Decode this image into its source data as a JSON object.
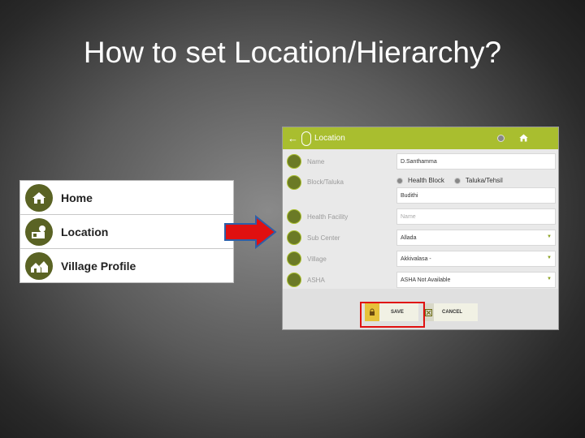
{
  "slide": {
    "title": "How to set Location/Hierarchy?"
  },
  "menu": {
    "items": [
      {
        "label": "Home",
        "icon": "home-icon"
      },
      {
        "label": "Location",
        "icon": "location-icon"
      },
      {
        "label": "Village Profile",
        "icon": "village-icon"
      }
    ]
  },
  "app": {
    "title": "Location",
    "fields": {
      "name": {
        "label": "Name",
        "value": "D.Santhamma"
      },
      "block": {
        "label": "Block/Taluka",
        "option1": "Health Block",
        "option2": "Taluka/Tehsil",
        "value": "Budithi"
      },
      "facility": {
        "label": "Health Facility",
        "placeholder": "Name"
      },
      "subcenter": {
        "label": "Sub Center",
        "value": "Allada"
      },
      "village": {
        "label": "Village",
        "value": "Akkivalasa -"
      },
      "asha": {
        "label": "ASHA",
        "value": "ASHA Not Available"
      }
    },
    "buttons": {
      "save": "SAVE",
      "cancel": "CANCEL"
    }
  },
  "colors": {
    "header": "#a9be2f",
    "icon": "#5a6324",
    "arrow": "#e01010",
    "highlight": "#e01010"
  }
}
